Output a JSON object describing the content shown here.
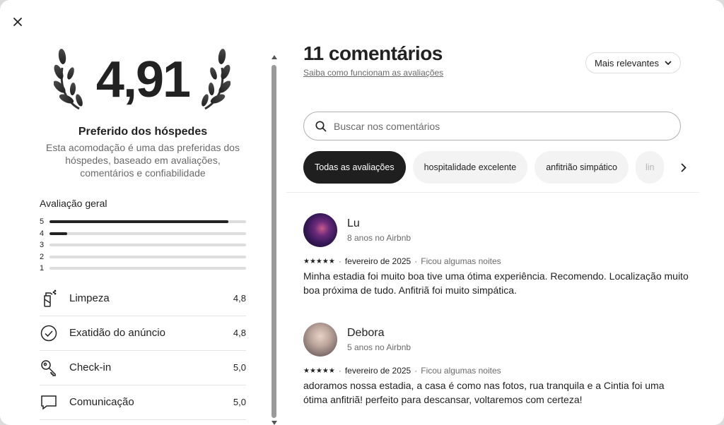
{
  "overall": {
    "score": "4,91",
    "badge_title": "Preferido dos hóspedes",
    "badge_desc": "Esta acomodação é uma das preferidas dos hóspedes, baseado em avaliações, comentários e confiabilidade",
    "section_title": "Avaliação geral",
    "distribution": [
      {
        "label": "5",
        "fraction": 0.91
      },
      {
        "label": "4",
        "fraction": 0.09
      },
      {
        "label": "3",
        "fraction": 0.0
      },
      {
        "label": "2",
        "fraction": 0.0
      },
      {
        "label": "1",
        "fraction": 0.0
      }
    ]
  },
  "categories": [
    {
      "label": "Limpeza",
      "value": "4,8",
      "icon": "spray-bottle-icon"
    },
    {
      "label": "Exatidão do anúncio",
      "value": "4,8",
      "icon": "check-circle-icon"
    },
    {
      "label": "Check-in",
      "value": "5,0",
      "icon": "key-icon"
    },
    {
      "label": "Comunicação",
      "value": "5,0",
      "icon": "chat-bubble-icon"
    }
  ],
  "reviews_header": {
    "title": "11 comentários",
    "how_link": "Saiba como funcionam as avaliações",
    "sort_label": "Mais relevantes"
  },
  "search": {
    "placeholder": "Buscar nos comentários"
  },
  "filters": [
    "Todas as avaliações",
    "hospitalidade excelente",
    "anfitrião simpático",
    "lin"
  ],
  "reviews": [
    {
      "name": "Lu",
      "since": "8 anos no Airbnb",
      "stars": "★★★★★",
      "date": "fevereiro de 2025",
      "stay": "Ficou algumas noites",
      "text": "Minha estadia foi muito boa tive uma ótima experiência. Recomendo. Localização muito boa próxima de tudo. Anfitriã foi muito simpática."
    },
    {
      "name": "Debora",
      "since": "5 anos no Airbnb",
      "stars": "★★★★★",
      "date": "fevereiro de 2025",
      "stay": "Ficou algumas noites",
      "text": "adoramos nossa estadia,  a casa é como nas fotos, rua tranquila e a Cintia foi uma ótima anfitriã! perfeito para descansar, voltaremos com certeza!"
    }
  ],
  "colors": {
    "text": "#222222",
    "muted": "#6a6a6a",
    "active_chip": "#1f1f1f",
    "chip_bg": "#f3f3f3"
  }
}
